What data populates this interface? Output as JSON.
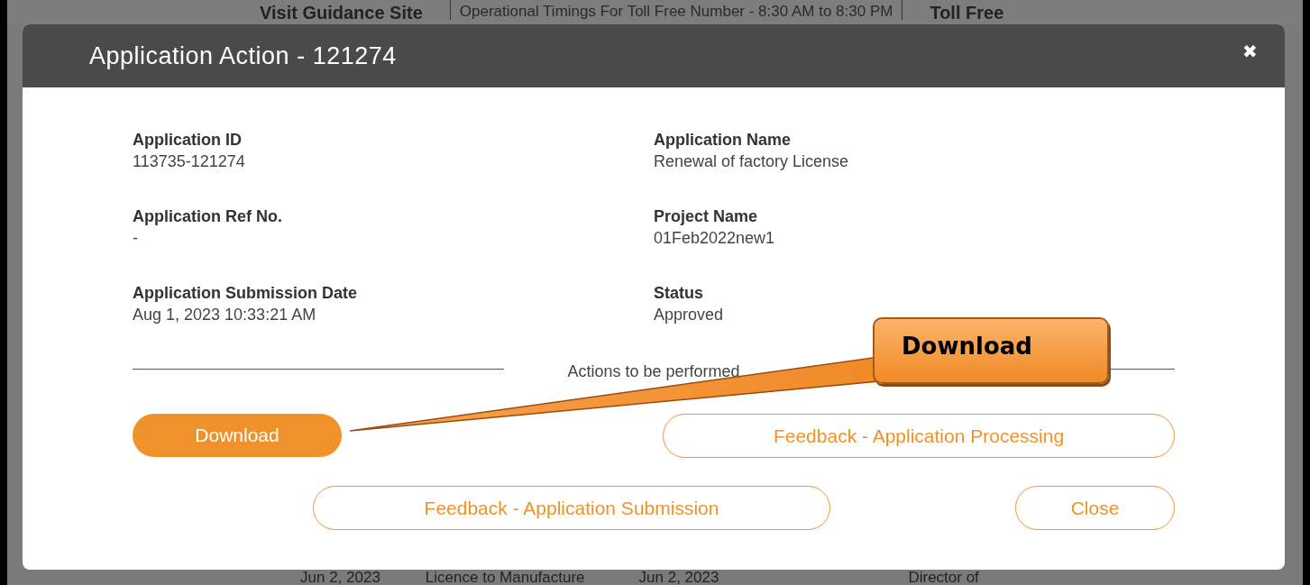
{
  "background": {
    "top_bar": [
      {
        "kind": "link",
        "text": "Visit Guidance Site"
      },
      {
        "kind": "notice",
        "text": "Operational Timings For Toll Free Number - 8:30 AM to 8:30 PM"
      },
      {
        "kind": "link",
        "text": "Toll Free"
      }
    ],
    "bottom_row": [
      "Jun 2, 2023",
      "Licence to Manufacture",
      "Jun 2, 2023",
      "Director of"
    ]
  },
  "modal": {
    "title": "Application Action - 121274",
    "close_icon": "✖",
    "fields": [
      {
        "label": "Application ID",
        "value": "113735-121274"
      },
      {
        "label": "Application Name",
        "value": "Renewal of factory License"
      },
      {
        "label": "Application Ref No.",
        "value": "-"
      },
      {
        "label": "Project Name",
        "value": "01Feb2022new1"
      },
      {
        "label": "Application Submission Date",
        "value": "Aug 1, 2023 10:33:21 AM"
      },
      {
        "label": "Status",
        "value": "Approved"
      }
    ],
    "section_heading": "Actions to be performed",
    "buttons": [
      {
        "label": "Download",
        "kind": "primary"
      },
      {
        "label": "Feedback - Application Processing",
        "kind": "outline"
      },
      {
        "label": "Feedback - Application Submission",
        "kind": "outline"
      },
      {
        "label": "Close",
        "kind": "outline"
      }
    ]
  },
  "callout": {
    "text": "Download"
  }
}
